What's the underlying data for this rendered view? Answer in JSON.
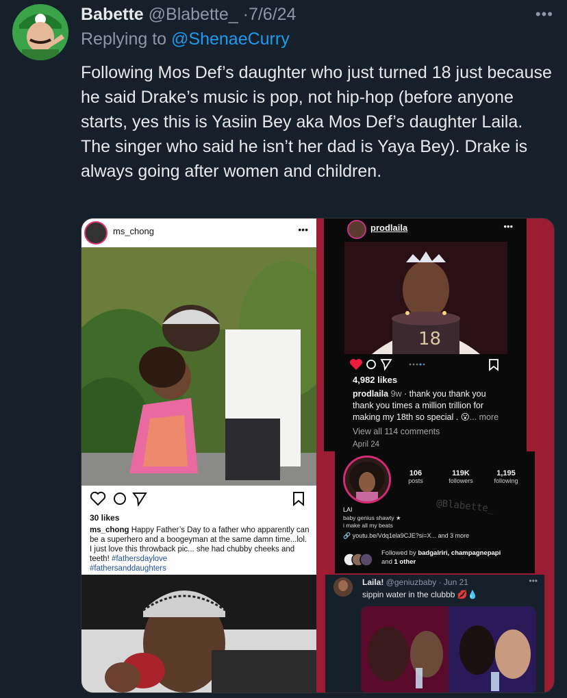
{
  "tweet": {
    "display_name": "Babette",
    "handle": "@Blabette_",
    "separator": "·",
    "date": "7/6/24",
    "more_label": "•••",
    "replying_prefix": "Replying to",
    "replying_to": "@ShenaeCurry",
    "text": "Following Mos Def’s daughter who just turned 18 just because he said Drake’s music is pop, not hip-hop (before anyone starts, yes this is Yasiin Bey aka Mos Def’s daughter Laila. The singer who said he isn’t her dad is Yaya Bey). Drake is always going after women and children."
  },
  "left_post": {
    "username": "ms_chong",
    "dots": "•••",
    "likes": "30 likes",
    "caption_user": "ms_chong",
    "caption_text": " Happy Father’s Day to a father who apparently can be a superhero and a boogeyman at the same damn time...lol. I just love this throwback pic... she had chubby cheeks and teeth! ",
    "tag1": "#fathersdaylove",
    "tag2": "#fathersanddaughters"
  },
  "right_post": {
    "username": "prodlaila",
    "dots": "•••",
    "likes": "4,982 likes",
    "caption_user": "prodlaila",
    "caption_time": " 9w",
    "caption_text": " · thank you thank you thank you times a million trillion for making my 18th so special . 😮",
    "caption_more": "... more",
    "view_comments": "View all 114 comments",
    "post_date": "April 24"
  },
  "profile": {
    "posts_n": "106",
    "posts_l": "posts",
    "followers_n": "119K",
    "followers_l": "followers",
    "following_n": "1,195",
    "following_l": "following",
    "name": "LAI",
    "bio1": "baby genius shawty ★",
    "bio2": "i make all my beats",
    "link": "youtu.be/Vdq1ela9CJE?si=X...  and 3 more",
    "followed_prefix": "Followed by ",
    "followed_users": "badgalriri, champagnepapi",
    "followed_suffix": " and ",
    "followed_other": "1 other",
    "watermark": "@Blabette_"
  },
  "inner_tweet": {
    "name": "Laila!",
    "meta": " @geniuzbaby · Jun 21",
    "dots": "•••",
    "text": "sippin water in the clubbb 💋💧"
  },
  "colors": {
    "bg": "#15202b",
    "accent": "#1d9bf0",
    "muted": "#8b98a5",
    "media_bg": "#9b1c33"
  }
}
